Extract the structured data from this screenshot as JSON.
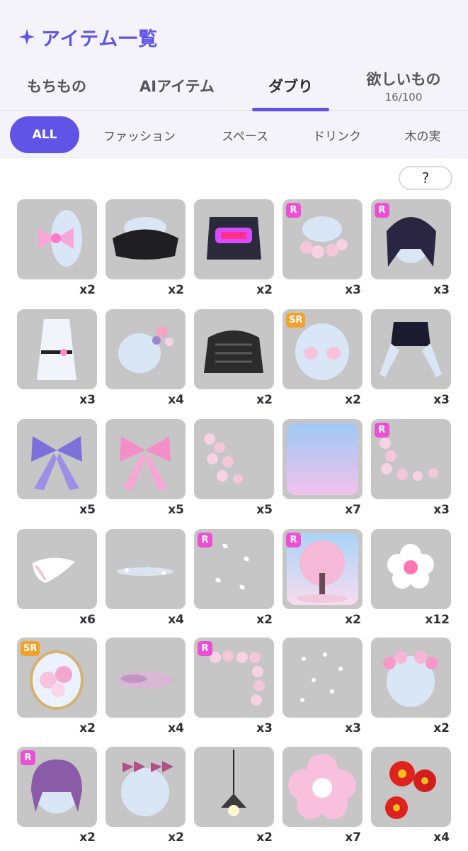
{
  "header": {
    "title": "アイテム一覧",
    "icon": "sparkle-icon",
    "accent": "#6054e6"
  },
  "tabs": [
    {
      "label": "もちもの",
      "sub": ""
    },
    {
      "label": "AIアイテム",
      "sub": ""
    },
    {
      "label": "ダブり",
      "sub": "",
      "active": true
    },
    {
      "label": "欲しいもの",
      "sub": "16/100"
    }
  ],
  "filters": [
    {
      "label": "ALL",
      "active": true
    },
    {
      "label": "ファッション"
    },
    {
      "label": "スペース"
    },
    {
      "label": "ドリンク"
    },
    {
      "label": "木の実"
    }
  ],
  "help_label": "?",
  "items": [
    {
      "name": "pink-bow-top-icon",
      "count": "x2",
      "rarity": ""
    },
    {
      "name": "black-offshoulder-top-icon",
      "count": "x2",
      "rarity": ""
    },
    {
      "name": "graffiti-tshirt-icon",
      "count": "x2",
      "rarity": ""
    },
    {
      "name": "sakura-collar-icon",
      "count": "x3",
      "rarity": "R"
    },
    {
      "name": "dark-purple-hair-icon",
      "count": "x3",
      "rarity": "R"
    },
    {
      "name": "white-kimono-icon",
      "count": "x3",
      "rarity": ""
    },
    {
      "name": "flower-hair-clip-icon",
      "count": "x4",
      "rarity": ""
    },
    {
      "name": "black-lace-top-icon",
      "count": "x2",
      "rarity": ""
    },
    {
      "name": "pink-eyes-icon",
      "count": "x2",
      "rarity": "SR"
    },
    {
      "name": "purple-crop-top-icon",
      "count": "x3",
      "rarity": ""
    },
    {
      "name": "purple-ribbon-icon",
      "count": "x5",
      "rarity": ""
    },
    {
      "name": "pink-ribbon-icon",
      "count": "x5",
      "rarity": ""
    },
    {
      "name": "sakura-branch-icon",
      "count": "x5",
      "rarity": ""
    },
    {
      "name": "gradient-wallpaper-icon",
      "count": "x7",
      "rarity": ""
    },
    {
      "name": "sakura-corner-icon",
      "count": "x3",
      "rarity": "R"
    },
    {
      "name": "white-petal-icon",
      "count": "x6",
      "rarity": ""
    },
    {
      "name": "sparkle-light-icon",
      "count": "x4",
      "rarity": ""
    },
    {
      "name": "falling-petals-icon",
      "count": "x2",
      "rarity": "R"
    },
    {
      "name": "sakura-tree-background-icon",
      "count": "x2",
      "rarity": "R"
    },
    {
      "name": "white-sakura-flower-icon",
      "count": "x12",
      "rarity": ""
    },
    {
      "name": "flower-jar-icon",
      "count": "x2",
      "rarity": "SR"
    },
    {
      "name": "pink-mist-icon",
      "count": "x4",
      "rarity": ""
    },
    {
      "name": "sakura-frame-icon",
      "count": "x3",
      "rarity": "R"
    },
    {
      "name": "petal-scatter-icon",
      "count": "x3",
      "rarity": ""
    },
    {
      "name": "sakura-headband-icon",
      "count": "x2",
      "rarity": ""
    },
    {
      "name": "purple-bob-hair-icon",
      "count": "x2",
      "rarity": "R"
    },
    {
      "name": "checkered-bows-icon",
      "count": "x2",
      "rarity": ""
    },
    {
      "name": "pendant-lamp-icon",
      "count": "x2",
      "rarity": ""
    },
    {
      "name": "sakura-cushion-icon",
      "count": "x7",
      "rarity": ""
    },
    {
      "name": "red-camellia-icon",
      "count": "x4",
      "rarity": ""
    }
  ]
}
